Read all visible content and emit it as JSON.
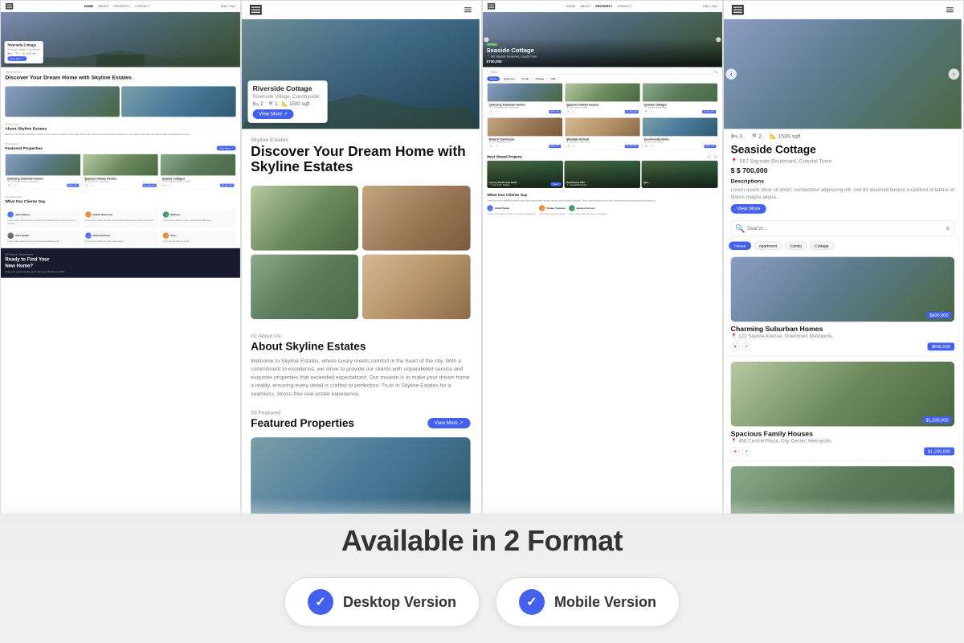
{
  "page": {
    "title": "Skyline Estates - Available in 2 Format",
    "available_text": "Available in 2 Format",
    "version_desktop": "Desktop Version",
    "version_mobile": "Mobile Version"
  },
  "panel1": {
    "nav": {
      "links": [
        "HOME",
        "ABOUT",
        "PROPERTY",
        "CONTACT"
      ],
      "lang": "ENG / INA"
    },
    "hero": {
      "property_name": "Riverside Cottage",
      "property_loc": "Riverside Village, Countryside",
      "beds": "2",
      "baths": "1",
      "area": "1500 sqft"
    },
    "section1": {
      "label": "Skyline Estates",
      "title": "Discover Your Dream Home with Skyline Estates"
    },
    "section2": {
      "label": "02  About Us",
      "title": "About Skyline Estates",
      "text": "Welcome to Skyline Estates, where luxury meets comfort in the heart of the city. With a commitment to excellence, we strive to provide our clients with unparalleled service."
    },
    "section3": {
      "label": "03  Featured",
      "title": "Featured Properties"
    },
    "properties": [
      {
        "name": "Charming Suburban Homes",
        "loc": "125 Bloom Avenue, Downtown Metropolis",
        "price": "$600,000"
      },
      {
        "name": "Spacious Family Houses",
        "loc": "490 Elm Pl Fwy, City Center, Metropolis",
        "price": "$1,200,000"
      },
      {
        "name": "Seaside Cottages",
        "loc": "567 Bayside Boulevard, Coastal Town",
        "price": "$3,500,000"
      }
    ],
    "section4": {
      "label": "04  Testimonials",
      "title": "What Our Clients Say"
    },
    "testimonials": [
      {
        "name": "John Daaver",
        "text": "Lorem ipsum dolor sit amet, consectetur adipiscing elit, sed do eiusmod tempor incididunt ut labore et dolore magna aliqua."
      },
      {
        "name": "Robert Robinson",
        "text": "Lorem ipsum dolor sit amet, consectetur adipiscing elit, sed do eiusmod tempor incididunt ut labore."
      },
      {
        "name": "Michael...",
        "text": "Lorem ipsum dolor sit amet, consectetur adipiscing."
      }
    ],
    "section5": {
      "label": "05  Discover Dream Home",
      "title": "Ready to Find Your New Home?",
      "text": "Start your search today and make your dream a reality!"
    }
  },
  "panel2": {
    "nav": {
      "menu_icon": "≡"
    },
    "hero": {
      "property_name": "Riverside Cottage",
      "property_loc": "Riverside Village, Countryside",
      "beds": "2",
      "baths": "1",
      "area": "1500 sqft"
    },
    "section1": {
      "label": "Skyline Estates",
      "title": "Discover Your Dream Home with Skyline Estates"
    },
    "section2": {
      "label": "02  About Us",
      "title": "About Skyline Estates",
      "text": "Welcome to Skyline Estates, where luxury meets comfort in the heart of the city. With a commitment to excellence, we strive to provide our clients with unparalleled service and exquisite properties that exceeded expectations. Our mission is to make your dream home a reality, ensuring every detail is crafted to perfection. Trust in Skyline Estates for a seamless, stress-free real estate experience."
    },
    "section3": {
      "label": "03  Featured",
      "title": "Featured Properties",
      "view_more": "View More"
    }
  },
  "panel3": {
    "nav": {
      "links": [
        "HOME",
        "ABOUT",
        "PROPERTY",
        "CONTACT"
      ],
      "lang": "ENG / INA",
      "active": "PROPERTY"
    },
    "hero": {
      "title": "Seaside Cottage",
      "loc": "567 Bayside Boulevard, Coastal Town",
      "price": "$700,000",
      "tag": "Contract"
    },
    "filters": [
      "House",
      "Apartment",
      "Condo",
      "Cottage",
      "Villa"
    ],
    "properties": [
      {
        "name": "Charming Suburban Homes",
        "loc": "125 Elm Avenue, Downtown Metropolis",
        "price": "$600,000"
      },
      {
        "name": "Spacious Family Houses",
        "loc": "356 Central Plaza, City Center, Metropolis",
        "price": "$1,200,000"
      },
      {
        "name": "Seaside Cottages",
        "loc": "783 Elm Street, Alta District, Savannah Metropolis",
        "price": "$3,500,000"
      },
      {
        "name": "Modern Townhouse",
        "loc": "134 Pleasanton Ave, Pleasanton, Suburbs",
        "price": "$600,000"
      },
      {
        "name": "Mountain Retreat",
        "loc": "556 Pine Valley Road, Pine Knolls, Countryside",
        "price": "$1,200,000"
      },
      {
        "name": "Eco-Friendly Home",
        "loc": "189 Grove Street, Eco District, Greentown",
        "price": "$940,000"
      }
    ],
    "most_viewed": {
      "title": "Most Viewed Property",
      "properties": [
        {
          "name": "Luxury Penthouse Suite",
          "loc": "Downtown Heights"
        },
        {
          "name": "Beachfront Villa",
          "loc": "Coastal Boulevard"
        },
        {
          "name": "Spa...",
          "loc": "..."
        }
      ]
    }
  },
  "panel4": {
    "nav": {
      "menu_icon": "≡"
    },
    "hero": {
      "title": "Seaside Cottage",
      "loc": "567 Bayside Boulevard, Coastal Town",
      "price": "$ 700,000",
      "area": "1539 sqft",
      "beds": "3",
      "baths": "2"
    },
    "description": {
      "label": "Descriptions",
      "text": "Lorem ipsum dolor sit amet, consectetur adipiscing elit, sed do eiusmod tempor incididunt ut labore et dolore magna aliqua..."
    },
    "view_more_btn": "View More",
    "search_placeholder": "Search...",
    "detail_filters": [
      "House",
      "Apartment",
      "Condo",
      "Cottage"
    ],
    "properties": [
      {
        "name": "Charming Suburban Homes",
        "loc": "123 Skyline Avenue, Downtown Metropolis",
        "price": "$600,000"
      },
      {
        "name": "Spacious Family Houses",
        "loc": "456 Central Plaza, City Center, Metropolis",
        "price": "$1,200,000"
      }
    ]
  }
}
